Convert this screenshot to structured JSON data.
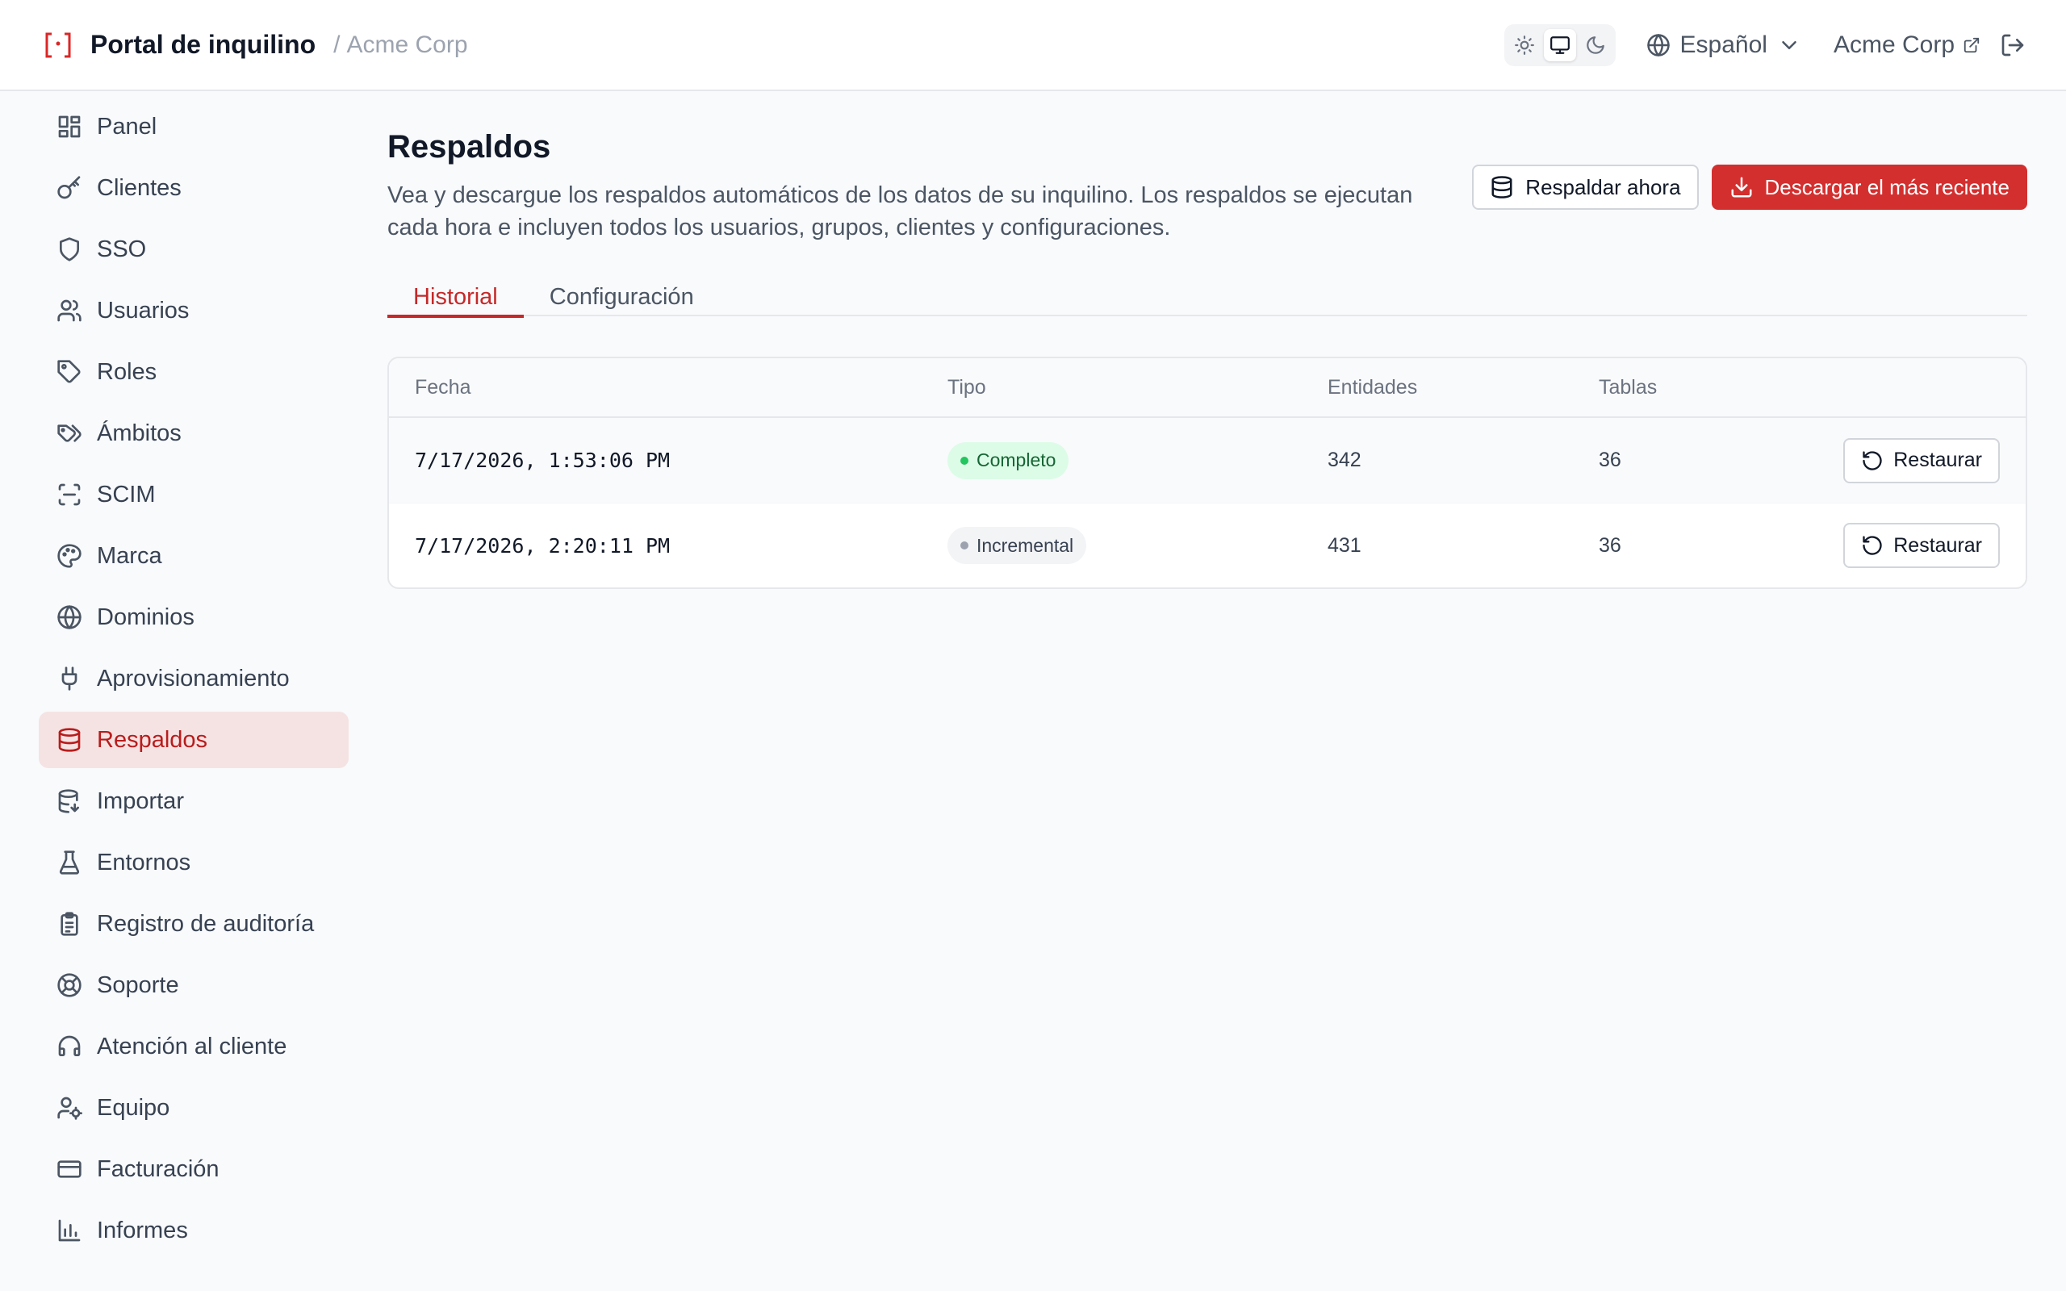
{
  "header": {
    "app_title": "Portal de inquilino",
    "breadcrumb_sep": "/",
    "breadcrumb": "Acme Corp",
    "theme_modes": [
      "light",
      "system",
      "dark"
    ],
    "theme_active": "system",
    "language": "Español",
    "tenant_link": "Acme Corp"
  },
  "sidebar": {
    "items": [
      {
        "label": "Panel",
        "icon": "dashboard-icon"
      },
      {
        "label": "Clientes",
        "icon": "key-icon"
      },
      {
        "label": "SSO",
        "icon": "shield-icon"
      },
      {
        "label": "Usuarios",
        "icon": "users-icon"
      },
      {
        "label": "Roles",
        "icon": "tag-icon"
      },
      {
        "label": "Ámbitos",
        "icon": "tags-icon"
      },
      {
        "label": "SCIM",
        "icon": "scan-icon"
      },
      {
        "label": "Marca",
        "icon": "palette-icon"
      },
      {
        "label": "Dominios",
        "icon": "globe-icon"
      },
      {
        "label": "Aprovisionamiento",
        "icon": "plug-icon"
      },
      {
        "label": "Respaldos",
        "icon": "database-icon",
        "active": true
      },
      {
        "label": "Importar",
        "icon": "database-import-icon"
      },
      {
        "label": "Entornos",
        "icon": "flask-icon"
      },
      {
        "label": "Registro de auditoría",
        "icon": "clipboard-icon"
      },
      {
        "label": "Soporte",
        "icon": "lifebuoy-icon"
      },
      {
        "label": "Atención al cliente",
        "icon": "headset-icon"
      },
      {
        "label": "Equipo",
        "icon": "user-cog-icon"
      },
      {
        "label": "Facturación",
        "icon": "credit-card-icon"
      },
      {
        "label": "Informes",
        "icon": "bar-chart-icon"
      }
    ]
  },
  "page": {
    "title": "Respaldos",
    "description": "Vea y descargue los respaldos automáticos de los datos de su inquilino. Los respaldos se ejecutan cada hora e incluyen todos los usuarios, grupos, clientes y configuraciones.",
    "backup_now_label": "Respaldar ahora",
    "download_latest_label": "Descargar el más reciente"
  },
  "tabs": [
    {
      "label": "Historial",
      "active": true
    },
    {
      "label": "Configuración",
      "active": false
    }
  ],
  "table": {
    "headers": {
      "date": "Fecha",
      "type": "Tipo",
      "entities": "Entidades",
      "tables": "Tablas"
    },
    "rows": [
      {
        "date": "7/17/2026, 1:53:06 PM",
        "type": "Completo",
        "type_status": "complete",
        "entities": "342",
        "tables": "36",
        "action": "Restaurar"
      },
      {
        "date": "7/17/2026, 2:20:11 PM",
        "type": "Incremental",
        "type_status": "incremental",
        "entities": "431",
        "tables": "36",
        "action": "Restaurar"
      }
    ]
  },
  "colors": {
    "accent": "#d32f2f",
    "active_nav_bg": "#f5e3e3",
    "success_badge_bg": "#dcfce7"
  }
}
